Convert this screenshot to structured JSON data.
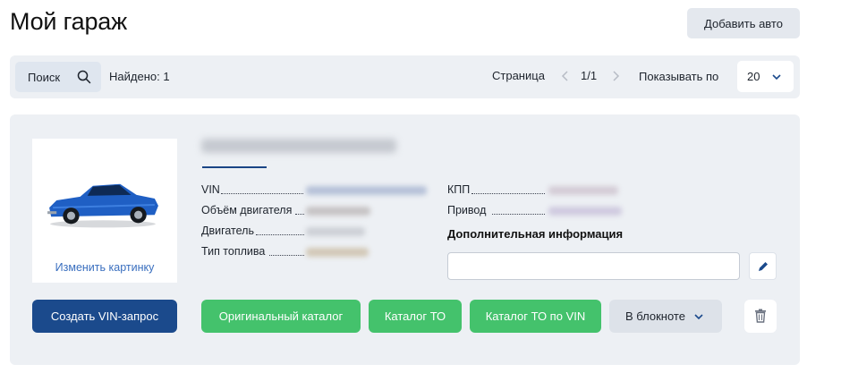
{
  "header": {
    "title": "Мой гараж",
    "add_car_label": "Добавить авто"
  },
  "toolbar": {
    "search_label": "Поиск",
    "search_icon": "search-icon",
    "found_label": "Найдено: 1",
    "page_label": "Страница",
    "page_value": "1/1",
    "perpage_label": "Показывать по",
    "perpage_value": "20"
  },
  "car": {
    "change_picture_label": "Изменить картинку",
    "specs": {
      "vin_label": "VIN",
      "engine_volume_label": "Объём двигателя",
      "engine_label": "Двигатель",
      "fuel_label": "Тип топлива",
      "gearbox_label": "КПП",
      "drive_label": "Привод"
    },
    "additional_info_label": "Дополнительная информация",
    "additional_info_value": ""
  },
  "actions": {
    "create_vin_request": "Создать VIN-запрос",
    "original_catalog": "Оригинальный каталог",
    "to_catalog": "Каталог ТО",
    "to_catalog_vin": "Каталог ТО по VIN",
    "notepad": "В блокноте"
  },
  "colors": {
    "primary_blue": "#1b4a8c",
    "action_green": "#44c26c",
    "panel_bg": "#edf0f4",
    "link_blue": "#3a6fbf"
  }
}
